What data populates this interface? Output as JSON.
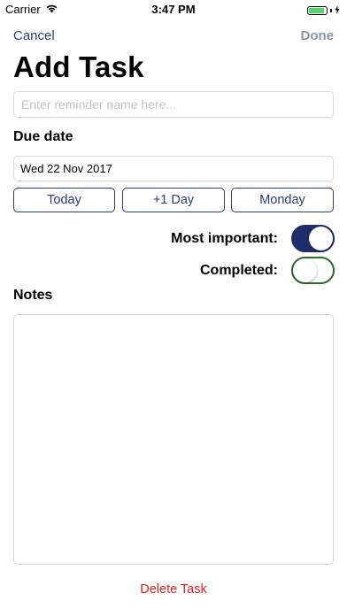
{
  "status_bar": {
    "carrier": "Carrier",
    "time": "3:47 PM",
    "wifi_icon": "wifi-icon",
    "battery_icon": "battery-icon",
    "charging_icon": "bolt-icon"
  },
  "nav": {
    "cancel_label": "Cancel",
    "done_label": "Done"
  },
  "page_title": "Add Task",
  "reminder_name": {
    "value": "",
    "placeholder": "Enter reminder name here..."
  },
  "due_date": {
    "label": "Due date",
    "value": "Wed 22 Nov 2017",
    "quick_buttons": [
      {
        "label": "Today"
      },
      {
        "label": "+1 Day"
      },
      {
        "label": "Monday"
      }
    ]
  },
  "toggles": {
    "most_important": {
      "label": "Most important:",
      "on": true
    },
    "completed": {
      "label": "Completed:",
      "on": false
    }
  },
  "notes": {
    "label": "Notes",
    "value": ""
  },
  "delete_label": "Delete Task",
  "colors": {
    "accent": "#2d3b79",
    "toggle_on": "#1f2d6b",
    "toggle_off_border": "#2f6b2a",
    "destructive": "#e8231f",
    "battery": "#4cd964"
  }
}
